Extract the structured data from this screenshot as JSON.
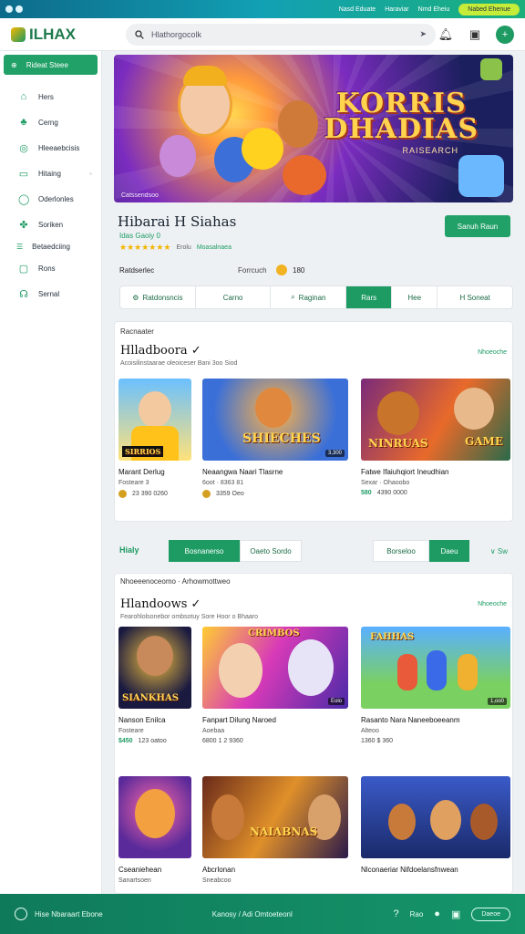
{
  "topbar": {
    "links": [
      "Nasd Eduate",
      "Haraviar",
      "Nmd Eheiu"
    ],
    "pill": "Nabed Ehenue"
  },
  "header": {
    "brand": "ILHAX",
    "search_placeholder": "Hlathorgocolk",
    "icons": [
      "send-icon",
      "bell-icon",
      "bag-icon",
      "plus-icon"
    ]
  },
  "sidebar": {
    "cta": "Rideat Steee",
    "items": [
      {
        "label": "Hers",
        "icon": "home-icon"
      },
      {
        "label": "Cerng",
        "icon": "gamepad-icon"
      },
      {
        "label": "Hleeaebcisis",
        "icon": "chat-icon"
      },
      {
        "label": "Hitaing",
        "icon": "trophy-icon"
      },
      {
        "label": "Oderlonles",
        "icon": "globe-icon"
      },
      {
        "label": "Soriken",
        "icon": "people-icon"
      },
      {
        "label": "Betaedciing",
        "icon": "list-icon"
      },
      {
        "label": "Rons",
        "icon": "calendar-icon"
      },
      {
        "label": "Sernal",
        "icon": "group-icon"
      }
    ]
  },
  "hero": {
    "title_line1": "KORRIS",
    "title_line2": "DHADIAS",
    "subtitle": "RAISEARCH",
    "caption": "Catsseridsoo"
  },
  "game": {
    "title": "Hibarai H Siahas",
    "subtitle": "Idas Gaoiy 0",
    "rating_stars": "★★★★★★★",
    "rating_meta": "Erolu",
    "rating_meta2": "Moasalnaea",
    "play_label": "Sanuh Raun",
    "row_label": "Ratdserlec",
    "row_value": "Forrcuch",
    "row_num": "180",
    "tabs": [
      {
        "label": "Ratdonsncis",
        "icon": "gear-icon",
        "active": false
      },
      {
        "label": "Carno",
        "icon": "",
        "active": false
      },
      {
        "label": "Raginan",
        "icon": "search-icon",
        "active": false
      },
      {
        "label": "Rars",
        "icon": "",
        "active": true
      },
      {
        "label": "Hee",
        "icon": "",
        "active": false
      },
      {
        "label": "H Soneat",
        "icon": "",
        "active": false
      }
    ]
  },
  "section1": {
    "kicker": "Racnaater",
    "title": "Hlladboora",
    "desc": "Acoisilinstaarae oleoiceser Bani 3oo Siod",
    "more": "Nhoeoche",
    "cards": [
      {
        "name": "Marant Derlug",
        "meta": "Fosteare 3",
        "price1": "",
        "price2": "23 390 0260",
        "tag": "SIRRIOS",
        "badge": ""
      },
      {
        "name": "Neaangwa Naari Tlasrne",
        "meta": "6oot · 8363 81",
        "price1": "",
        "price2": "3359 Oeo",
        "tag": "SHIECHES",
        "badge": "3,300"
      },
      {
        "name": "Fatwe Ifaiuhqiort Ineudhian",
        "meta": "Sexar · Ohaoobo",
        "price1": "580",
        "price2": "4390 0000",
        "tag": "NINRUAS",
        "badge": "GAME"
      }
    ]
  },
  "filter": {
    "label": "Hialy",
    "tabs": [
      "Bosnanerso",
      "Oaeto Sordo",
      "Borseloo",
      "Daeu"
    ],
    "mini": "Sw"
  },
  "section2": {
    "kicker": "Nhoeeenoceomo · Arhowmottweo",
    "title": "Hlandoows",
    "desc": "Fearohlolsonebor ombsotuy Sore Hoor o Bhaaro",
    "more": "Nhoeoche",
    "cards": [
      {
        "name": "Nanson Enilca",
        "meta": "Fosteare",
        "price1": "$450",
        "price2": "123 oatoo",
        "tag": "SIANKHAS",
        "badge": ""
      },
      {
        "name": "Fanpart Dilung Naroed",
        "meta": "Aoebaa",
        "price1": "",
        "price2": "6800 1 2 9360",
        "tag": "CRIMBOS",
        "badge": "Eolo"
      },
      {
        "name": "Rasanto Nara Naneeboeeanm",
        "meta": "Alteoo",
        "price1": "",
        "price2": "1360 $ 360",
        "tag": "FAHHAS",
        "badge": "1,oo0"
      },
      {
        "name": "Cseaniehean",
        "meta": "Sanartsoen",
        "price1": "",
        "price2": "",
        "tag": "",
        "badge": ""
      },
      {
        "name": "Abcrlonan",
        "meta": "Sneabcoo",
        "price1": "",
        "price2": "",
        "tag": "NAIABNAS",
        "badge": ""
      },
      {
        "name": "Nlconaeriar Nifdoelansfnwean",
        "meta": "",
        "price1": "",
        "price2": "",
        "tag": "",
        "badge": ""
      }
    ]
  },
  "bottom": {
    "left_text": "Hise Nbaraart Ebone",
    "mid_text": "Kanosy / Adi Omtoeteonl",
    "right_label": "Rao",
    "button": "Daeoe"
  }
}
